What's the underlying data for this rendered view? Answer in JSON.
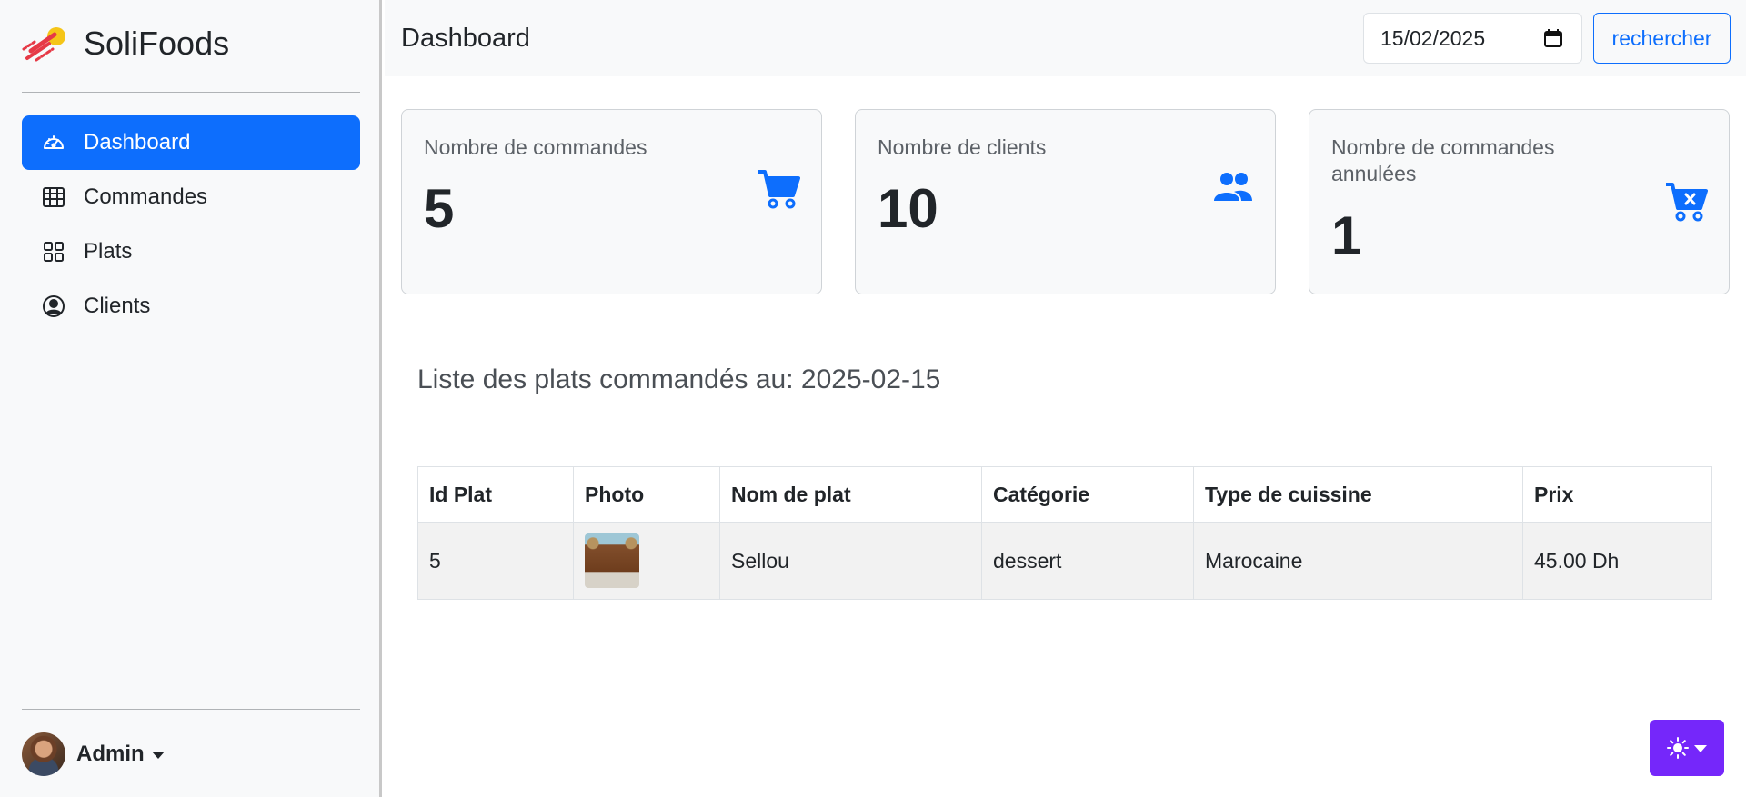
{
  "brand": {
    "name": "SoliFoods"
  },
  "sidebar": {
    "items": [
      {
        "label": "Dashboard",
        "icon": "speedometer-icon",
        "active": true
      },
      {
        "label": "Commandes",
        "icon": "table-icon"
      },
      {
        "label": "Plats",
        "icon": "grid-icon"
      },
      {
        "label": "Clients",
        "icon": "person-circle-icon"
      }
    ],
    "user": {
      "name": "Admin"
    }
  },
  "header": {
    "title": "Dashboard",
    "date_value": "15/02/2025",
    "search_label": "rechercher"
  },
  "cards": [
    {
      "label": "Nombre de commandes",
      "value": "5",
      "icon": "cart-icon"
    },
    {
      "label": "Nombre de clients",
      "value": "10",
      "icon": "people-icon"
    },
    {
      "label": "Nombre de commandes annulées",
      "value": "1",
      "icon": "cart-x-icon"
    }
  ],
  "list": {
    "title": "Liste des plats commandés au: 2025-02-15",
    "columns": [
      "Id Plat",
      "Photo",
      "Nom de plat",
      "Catégorie",
      "Type de cuissine",
      "Prix"
    ],
    "rows": [
      {
        "id": "5",
        "name": "Sellou",
        "category": "dessert",
        "cuisine": "Marocaine",
        "price": "45.00 Dh"
      }
    ]
  },
  "colors": {
    "accent": "#0d6efd",
    "theme_button": "#7527fa",
    "sidebar_bg": "#f8f9fa"
  }
}
